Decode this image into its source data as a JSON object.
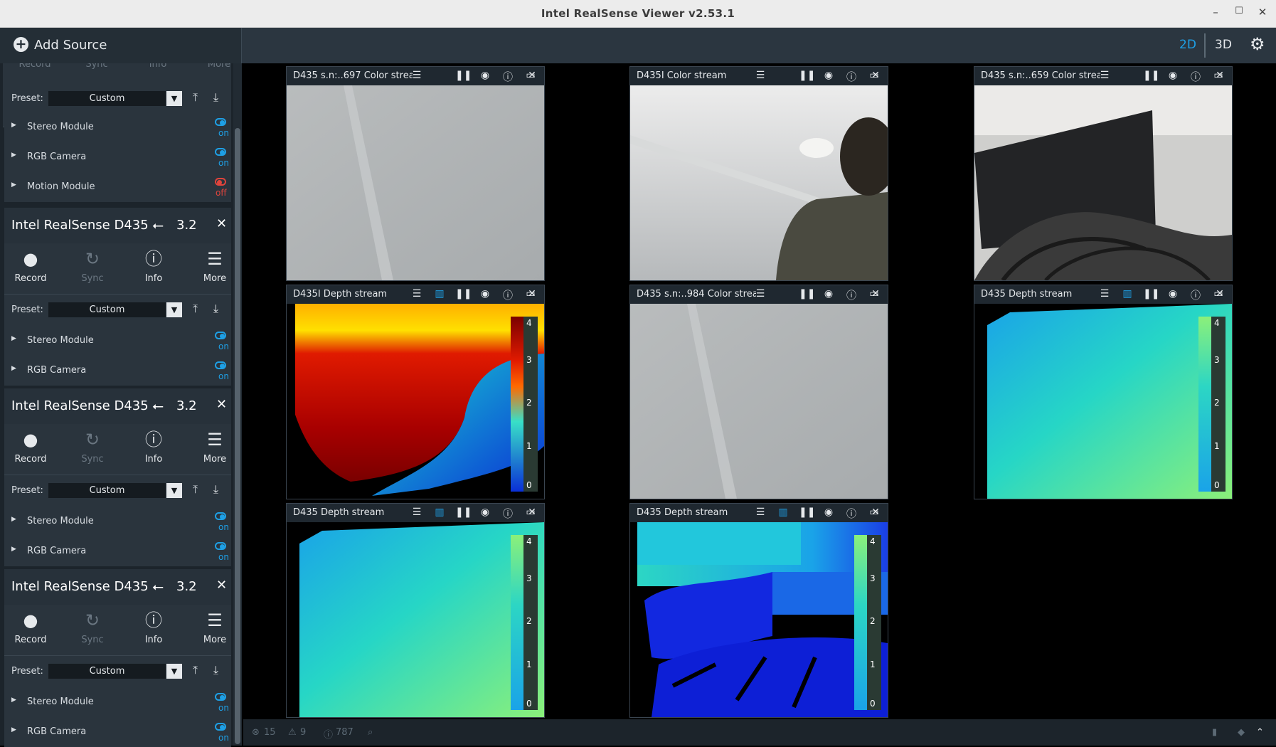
{
  "window": {
    "title": "Intel RealSense Viewer v2.53.1",
    "minimize": "–",
    "maximize": "☐",
    "close": "✕"
  },
  "topbar": {
    "add_source": "Add Source",
    "mode_2d": "2D",
    "mode_3d": "3D",
    "active_mode": "2D"
  },
  "partial_device": {
    "tool_labels": [
      "Record",
      "Sync",
      "Info",
      "More"
    ],
    "preset_label": "Preset:",
    "preset_value": "Custom",
    "modules": [
      {
        "name": "Stereo Module",
        "state": "on"
      },
      {
        "name": "RGB Camera",
        "state": "on"
      },
      {
        "name": "Motion Module",
        "state": "off"
      }
    ]
  },
  "devices": [
    {
      "name": "Intel RealSense D435",
      "usb": "3.2",
      "tools": [
        "Record",
        "Sync",
        "Info",
        "More"
      ],
      "preset_label": "Preset:",
      "preset_value": "Custom",
      "modules": [
        {
          "name": "Stereo Module",
          "state": "on"
        },
        {
          "name": "RGB Camera",
          "state": "on"
        }
      ]
    },
    {
      "name": "Intel RealSense D435",
      "usb": "3.2",
      "tools": [
        "Record",
        "Sync",
        "Info",
        "More"
      ],
      "preset_label": "Preset:",
      "preset_value": "Custom",
      "modules": [
        {
          "name": "Stereo Module",
          "state": "on"
        },
        {
          "name": "RGB Camera",
          "state": "on"
        }
      ]
    },
    {
      "name": "Intel RealSense D435",
      "usb": "3.2",
      "tools": [
        "Record",
        "Sync",
        "Info",
        "More"
      ],
      "preset_label": "Preset:",
      "preset_value": "Custom",
      "modules": [
        {
          "name": "Stereo Module",
          "state": "on"
        },
        {
          "name": "RGB Camera",
          "state": "on"
        }
      ]
    }
  ],
  "streams": [
    {
      "title": "D435 s.n:..697 Color strear",
      "type": "color",
      "scene": "ceiling"
    },
    {
      "title": "D435I Color stream",
      "type": "color",
      "scene": "person"
    },
    {
      "title": "D435 s.n:..659 Color strear",
      "type": "color",
      "scene": "monitor"
    },
    {
      "title": "D435I Depth stream",
      "type": "depth",
      "scene": "heat"
    },
    {
      "title": "D435 s.n:..984 Color strear",
      "type": "color",
      "scene": "ceiling"
    },
    {
      "title": "D435 Depth stream",
      "type": "depth",
      "scene": "wall"
    },
    {
      "title": "D435 Depth stream",
      "type": "depth",
      "scene": "wall"
    },
    {
      "title": "D435 Depth stream",
      "type": "depth",
      "scene": "room"
    }
  ],
  "depth_scale_ticks": [
    "4",
    "3",
    "2",
    "1",
    "0"
  ],
  "footer": {
    "errors": "15",
    "warnings": "9",
    "info": "787"
  },
  "colors": {
    "accent": "#1ea0e6",
    "off": "#e0443c",
    "panel": "#2a343d",
    "header": "#27313a"
  }
}
